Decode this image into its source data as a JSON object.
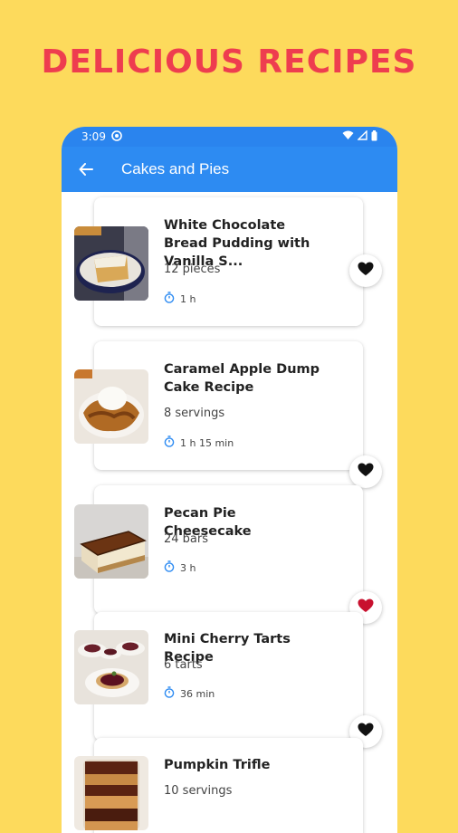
{
  "promo": {
    "headline": "DELICIOUS RECIPES"
  },
  "status_bar": {
    "time": "3:09"
  },
  "app_bar": {
    "title": "Cakes and Pies"
  },
  "recipes": [
    {
      "title": "White Chocolate Bread Pudding with Vanilla S...",
      "yield": "12 pieces",
      "time": "1 h",
      "favorite_color": "#111111"
    },
    {
      "title": "Caramel Apple Dump Cake Recipe",
      "yield": "8 servings",
      "time": "1 h 15 min",
      "favorite_color": "#111111"
    },
    {
      "title": "Pecan Pie Cheesecake",
      "yield": "24 bars",
      "time": "3 h",
      "favorite_color": "#C8102E"
    },
    {
      "title": "Mini Cherry Tarts Recipe",
      "yield": "6 tarts",
      "time": "36 min",
      "favorite_color": "#111111"
    },
    {
      "title": "Pumpkin Trifle",
      "yield": "10 servings",
      "time": "",
      "favorite_color": "#C8102E"
    }
  ],
  "colors": {
    "background": "#FDDA5C",
    "headline": "#EE3D4F",
    "app_bar": "#2D8BF2",
    "timer_icon": "#2D8BF2"
  }
}
